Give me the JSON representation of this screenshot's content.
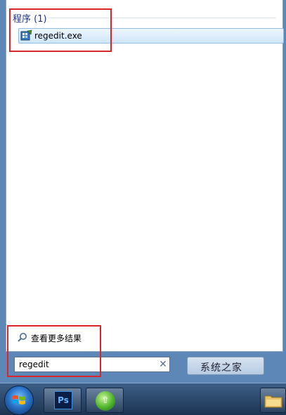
{
  "results": {
    "group_label": "程序 (1)",
    "items": [
      {
        "label": "regedit.exe",
        "icon": "regedit-icon"
      }
    ]
  },
  "more_results": {
    "label": "查看更多结果",
    "icon": "search-icon"
  },
  "search": {
    "value": "regedit",
    "clear_icon": "clear-icon"
  },
  "shutdown": {
    "label": "系统之家"
  },
  "taskbar": {
    "items": [
      {
        "name": "start-button",
        "icon": "windows-flag-icon"
      },
      {
        "name": "photoshop",
        "icon": "photoshop-icon",
        "text": "Ps"
      },
      {
        "name": "browser",
        "icon": "browser-icon"
      },
      {
        "name": "folder",
        "icon": "folder-icon"
      }
    ]
  },
  "colors": {
    "highlight_red": "#d9262a",
    "selection_border": "#8fbde8",
    "group_header": "#1e3287"
  }
}
